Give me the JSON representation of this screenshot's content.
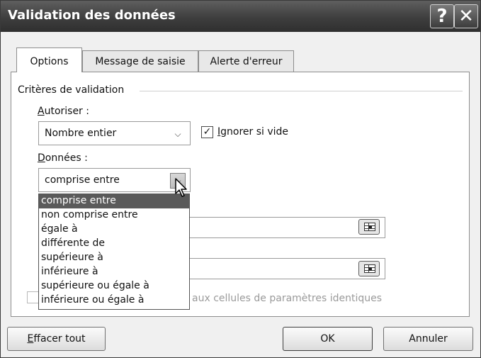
{
  "window": {
    "title": "Validation des données",
    "help_symbol": "?",
    "close_symbol": "✕"
  },
  "tabs": [
    {
      "label": "Options",
      "active": true
    },
    {
      "label": "Message de saisie",
      "active": false
    },
    {
      "label": "Alerte d'erreur",
      "active": false
    }
  ],
  "criteria": {
    "group_label": "Critères de validation",
    "autoriser": {
      "label_first": "A",
      "label_rest": "utoriser :",
      "value": "Nombre entier"
    },
    "ignore_blank": {
      "label_first": "I",
      "label_rest": "gnorer si vide",
      "checked": true,
      "check_glyph": "✓"
    },
    "donnees": {
      "label_first": "D",
      "label_rest": "onnées :",
      "value": "comprise entre"
    },
    "dropdown_options": [
      "comprise entre",
      "non comprise entre",
      "égale à",
      "différente de",
      "supérieure à",
      "inférieure à",
      "supérieure ou égale à",
      "inférieure ou égale à"
    ],
    "selected_option": "comprise entre",
    "apply_label": "aux cellules de paramètres identiques"
  },
  "buttons": {
    "clear_first": "E",
    "clear_rest": "ffacer tout",
    "ok": "OK",
    "cancel": "Annuler"
  },
  "icons": {
    "arrow": "chevron-down-icon",
    "ref": "range-select-icon",
    "cursor": "mouse-pointer-icon"
  }
}
